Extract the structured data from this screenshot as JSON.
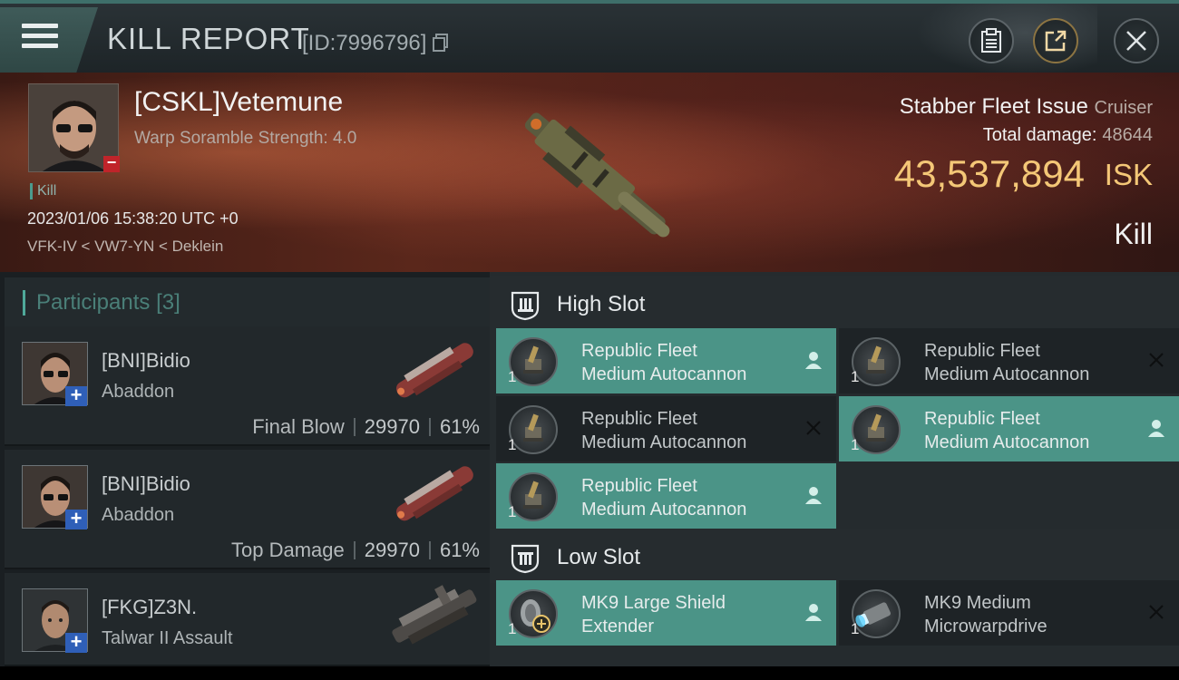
{
  "header": {
    "title": "KILL REPORT",
    "id_label": "[ID:7996796]",
    "buttons": {
      "clipboard_icon": "clipboard-icon",
      "share_icon": "share-icon",
      "close_icon": "close-icon"
    }
  },
  "victim": {
    "name": "[CSKL]Vetemune",
    "warp_scramble": "Warp Soramble Strength: 4.0",
    "tag": "Kill",
    "datetime": "2023/01/06 15:38:20 UTC +0",
    "location": "VFK-IV < VW7-YN < Deklein",
    "ship_name": "Stabber Fleet Issue",
    "ship_class": "Cruiser",
    "total_damage_label": "Total damage:",
    "total_damage": "48644",
    "isk_value": "43,537,894",
    "isk_unit": "ISK",
    "result": "Kill"
  },
  "participants": {
    "title": "Participants",
    "count": "[3]",
    "items": [
      {
        "name": "[BNI]Bidio",
        "ship": "Abaddon",
        "label": "Final Blow",
        "damage": "29970",
        "percent": "61%"
      },
      {
        "name": "[BNI]Bidio",
        "ship": "Abaddon",
        "label": "Top Damage",
        "damage": "29970",
        "percent": "61%"
      },
      {
        "name": "[FKG]Z3N.",
        "ship": "Talwar II Assault",
        "label": "",
        "damage": "",
        "percent": ""
      }
    ]
  },
  "fitting": {
    "high_slot": {
      "title": "High Slot",
      "modules": [
        {
          "line1": "Republic Fleet",
          "line2": "Medium Autocannon",
          "qty": "1",
          "status": "dropped"
        },
        {
          "line1": "Republic Fleet",
          "line2": "Medium Autocannon",
          "qty": "1",
          "status": "destroyed"
        },
        {
          "line1": "Republic Fleet",
          "line2": "Medium Autocannon",
          "qty": "1",
          "status": "destroyed"
        },
        {
          "line1": "Republic Fleet",
          "line2": "Medium Autocannon",
          "qty": "1",
          "status": "dropped"
        },
        {
          "line1": "Republic Fleet",
          "line2": "Medium Autocannon",
          "qty": "1",
          "status": "dropped"
        }
      ]
    },
    "low_slot": {
      "title": "Low Slot",
      "modules": [
        {
          "line1": "MK9 Large Shield",
          "line2": "Extender",
          "qty": "1",
          "status": "dropped"
        },
        {
          "line1": "MK9 Medium",
          "line2": "Microwarpdrive",
          "qty": "1",
          "status": "destroyed"
        }
      ]
    }
  },
  "colors": {
    "accent_teal": "#4b9487",
    "isk_gold": "#f4c777",
    "header_bg": "#1d2427",
    "badge_red": "#c0242a",
    "badge_blue": "#2f5fb8"
  }
}
